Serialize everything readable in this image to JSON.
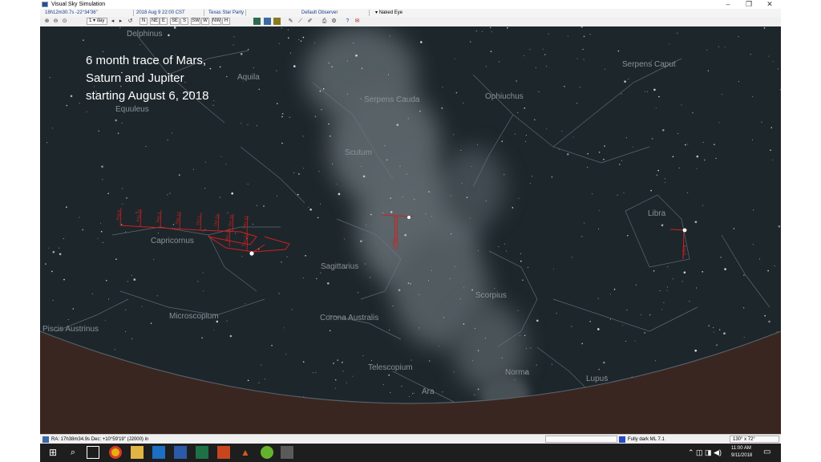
{
  "window": {
    "title": "Visual Sky Simulation",
    "minimize": "–",
    "restore": "❐",
    "close": "✕"
  },
  "status": {
    "coords": "18h12m30.7s -22°34'36\"",
    "date_time": "2018 Aug 9     22:00   CST",
    "location": "Texas Star Party",
    "observer": "Default Observer",
    "view": "Naked Eye"
  },
  "toolbar": {
    "step": "1",
    "unit": "day",
    "directions": [
      "N",
      "NE",
      "E",
      "SE",
      "S",
      "SW",
      "W",
      "NW",
      "H"
    ]
  },
  "overlay_text": [
    "6 month trace of Mars,",
    "Saturn and Jupiter",
    "starting August 6, 2018"
  ],
  "constellations": [
    "Delphinus",
    "Aquila",
    "Equuleus",
    "Serpens Cauda",
    "Serpens Caput",
    "Ophiuchus",
    "Scutum",
    "Libra",
    "Capricornus",
    "Sagittarius",
    "Scorpius",
    "Microscopium",
    "Corona Australis",
    "Piscis Austrinus",
    "Telescopium",
    "Norma",
    "Lupus",
    "Ara"
  ],
  "mars_dates": [
    "Aug 6",
    "Aug 20",
    "Sep 3",
    "Sep 17",
    "Oct 1",
    "Oct 15",
    "Oct 29",
    "Nov 12",
    "Nov 26",
    "Dec 10"
  ],
  "jupiter_date": "Aug 6",
  "saturn_date": "Aug 6",
  "bottom": {
    "ra_dec": "RA:  17h38m34.9s  Dec: +10°59'19\" (J2000) in",
    "sky_quality": "Fully dark ML 7.1",
    "fov": "130° x 72°"
  },
  "taskbar": {
    "time": "11:00 AM",
    "date": "9/11/2018"
  },
  "colors": {
    "sky": "#1d262b",
    "horizon": "#3a2620",
    "trace": "#d02020",
    "constellation_label": "#8a9297"
  }
}
